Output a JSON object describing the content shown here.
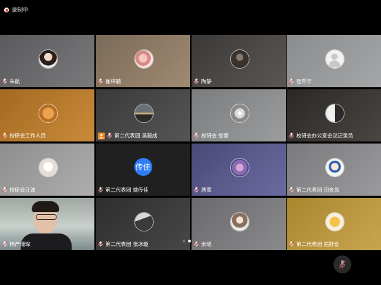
{
  "recording": {
    "label": "录制中"
  },
  "participants": [
    {
      "name": "朱航",
      "bg": "linear-gradient(135deg,#5a5a5c,#7a7a7c)",
      "avatar": "photo-girl"
    },
    {
      "name": "崔梓毓",
      "bg": "linear-gradient(135deg,#7a6a58,#a08a72)",
      "avatar": "photo-pink"
    },
    {
      "name": "陶静",
      "bg": "linear-gradient(135deg,#3c3a38,#5a5654)",
      "avatar": "photo-dark"
    },
    {
      "name": "张乔宇",
      "bg": "linear-gradient(135deg,#8a8c8e,#a4a6a8)",
      "avatar": "default-person"
    },
    {
      "name": "校研会工作人员",
      "bg": "linear-gradient(135deg,#a46a22,#c98a3a)",
      "avatar": "photo-dog"
    },
    {
      "name": "第二代表团 吴毅成",
      "bg": "linear-gradient(135deg,#3a3a3a,#555)",
      "avatar": "photo-sunset",
      "host": true
    },
    {
      "name": "校研会 张豪",
      "bg": "linear-gradient(135deg,#7a7c7e,#9a9c9e)",
      "avatar": "photo-light"
    },
    {
      "name": "校研会办公室会议记录员",
      "bg": "linear-gradient(135deg,#2a2826,#4a4642)",
      "avatar": "photo-bw"
    },
    {
      "name": "校研会江波",
      "bg": "linear-gradient(135deg,#8e8e8e,#adadad)",
      "avatar": "photo-cartoon"
    },
    {
      "name": "第二代表团 姚传佳",
      "bg": "#202020",
      "avatar": "text",
      "avatar_text": "传佳"
    },
    {
      "name": "唐翠",
      "bg": "linear-gradient(135deg,#4a4a78,#6a6aa0)",
      "avatar": "photo-flower"
    },
    {
      "name": "第二代表团 田金凤",
      "bg": "linear-gradient(135deg,#7a7a7c,#9a9a9c)",
      "avatar": "photo-anime"
    },
    {
      "name": "杨严瑾琛",
      "bg": "",
      "avatar": "video",
      "speaking": true
    },
    {
      "name": "第二代表团 张冰璇",
      "bg": "linear-gradient(135deg,#2e2e2e,#474747)",
      "avatar": "photo-shadow"
    },
    {
      "name": "余瑶",
      "bg": "linear-gradient(135deg,#6a6a6c,#8a8a8c)",
      "avatar": "photo-girl2"
    },
    {
      "name": "第二代表团 屈舒音",
      "bg": "linear-gradient(135deg,#a8862e,#c8a44e)",
      "avatar": "photo-cat"
    }
  ],
  "pager": {
    "pages": 3,
    "active": 1
  },
  "icons": {
    "mic": "mic-muted-icon",
    "host": "host-icon",
    "record": "record-dot-icon"
  },
  "colors": {
    "speaking": "#2ecc71",
    "host": "#f08a1c",
    "record": "#e53935",
    "avatar_text_bg": "#2f7cf6"
  }
}
